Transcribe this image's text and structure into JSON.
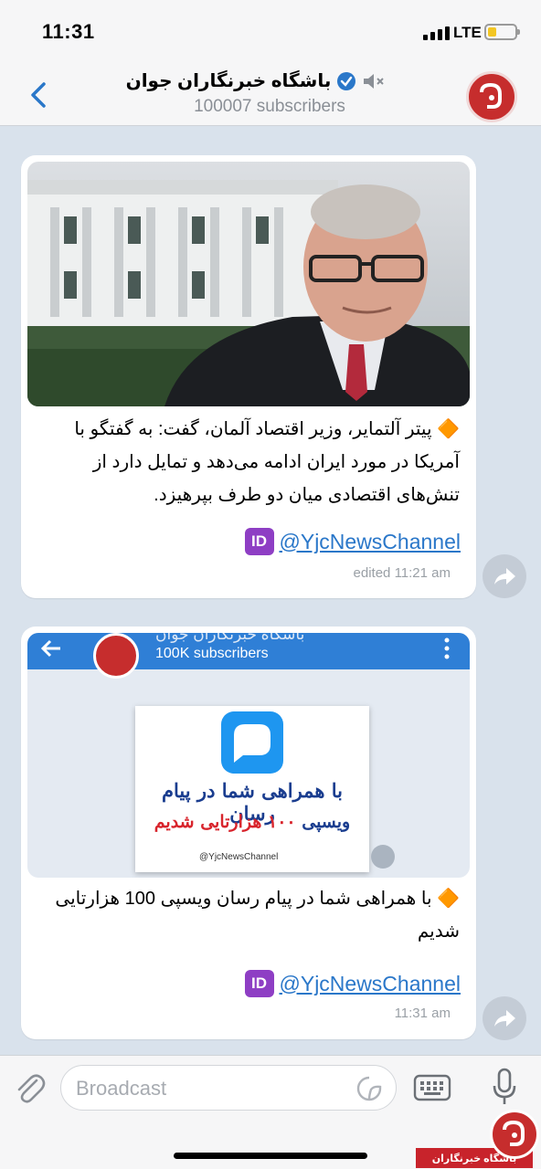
{
  "status_bar": {
    "time": "11:31",
    "network": "LTE"
  },
  "header": {
    "back_label": "<",
    "channel_name": "باشگاه خبرنگاران جوان",
    "subscribers": "100007 subscribers"
  },
  "messages": [
    {
      "text": "🔶 پیتر آلتمایر، وزیر اقتصاد آلمان، گفت: به گفتگو با آمریکا در مورد ایران ادامه می‌دهد و تمایل دارد از تنش‌های اقتصادی میان دو طرف بپرهیزد.",
      "id_badge": "ID",
      "tag": "@YjcNewsChannel",
      "meta": "edited 11:21 am"
    },
    {
      "embedded": {
        "channel_name": "باشگاه خبرنگاران جوان",
        "subscribers": "100K subscribers",
        "card_line1": "با همراهی شما در پیام رسان",
        "card_line2": "ویسپی",
        "card_line3": "۱۰۰ هزارتایی شدیم",
        "card_tag": "@YjcNewsChannel"
      },
      "text": "🔶 با همراهی شما در پیام رسان ویسپی 100 هزارتایی شدیم",
      "id_badge": "ID",
      "tag": "@YjcNewsChannel",
      "meta": "11:31 am"
    }
  ],
  "input": {
    "placeholder": "Broadcast"
  },
  "watermark": {
    "text": "باشگاه خبرنگاران"
  },
  "colors": {
    "accent": "#2a77c9",
    "brand_red": "#c62d2d",
    "id_purple": "#8e3ec4"
  }
}
